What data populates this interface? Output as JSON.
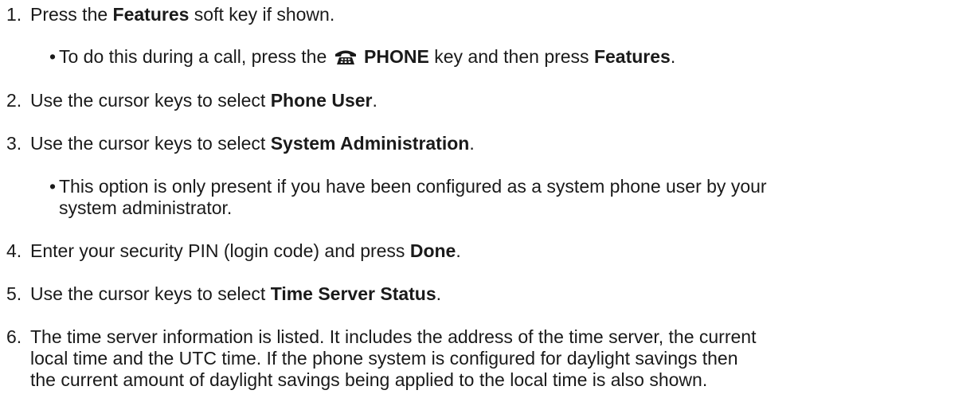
{
  "steps": [
    {
      "num": "1.",
      "pre": "Press the ",
      "bold": "Features",
      "post": " soft key if shown.",
      "sub": {
        "bullet": "•",
        "pre": "To do this during a call, press the ",
        "icon": "phone-icon",
        "bold1": "PHONE",
        "mid": " key and then press ",
        "bold2": "Features",
        "post": "."
      }
    },
    {
      "num": "2.",
      "pre": "Use the cursor keys to select ",
      "bold": "Phone User",
      "post": "."
    },
    {
      "num": "3.",
      "pre": "Use the cursor keys to select ",
      "bold": "System Administration",
      "post": ".",
      "sub": {
        "bullet": "•",
        "line1": "This option is only present if you have been configured as a system phone user by your",
        "line2": "system administrator."
      }
    },
    {
      "num": "4.",
      "pre": "Enter your security PIN (login code) and press ",
      "bold": "Done",
      "post": "."
    },
    {
      "num": "5.",
      "pre": "Use the cursor keys to select ",
      "bold": "Time Server Status",
      "post": "."
    },
    {
      "num": "6.",
      "line1": "The time server information is listed. It includes the address of the time server, the current",
      "line2": "local time and the UTC time. If the phone system is configured for daylight savings then",
      "line3": "the current amount of daylight savings being applied to the local time is also shown."
    }
  ]
}
